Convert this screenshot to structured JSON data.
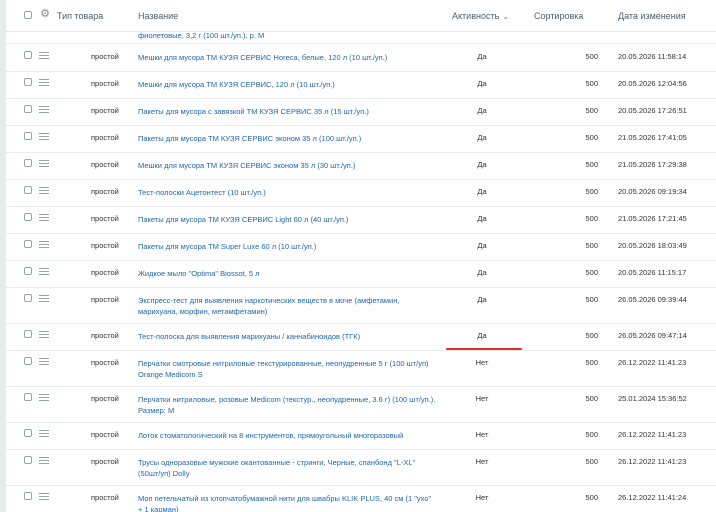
{
  "header": {
    "type_label": "Тип товара",
    "name_label": "Название",
    "activity_label": "Активность",
    "sort_label": "Сортировка",
    "date_label": "Дата изменения"
  },
  "partial_row_text": "фиолетовые, 3,2 г (100 шт./уп.), р. M",
  "rows": [
    {
      "type": "простой",
      "name": "Мешки для мусора ТМ КУЗЯ СЕРВИС Horeca, белые, 120 л (10 шт./уп.)",
      "active": "Да",
      "sort": "500",
      "date": "20.05.2026 11:58:14"
    },
    {
      "type": "простой",
      "name": "Мешки для мусора ТМ КУЗЯ СЕРВИС, 120 л (10 шт./уп.)",
      "active": "Да",
      "sort": "500",
      "date": "20.05.2026 12:04:56"
    },
    {
      "type": "простой",
      "name": "Пакеты для мусора с завязкой ТМ КУЗЯ СЕРВИС 35 л (15 шт./уп.)",
      "active": "Да",
      "sort": "500",
      "date": "20.05.2026 17:26:51"
    },
    {
      "type": "простой",
      "name": "Пакеты для мусора ТМ КУЗЯ СЕРВИС эконом 35 л (100 шт./уп.)",
      "active": "Да",
      "sort": "500",
      "date": "21.05.2026 17:41:05"
    },
    {
      "type": "простой",
      "name": "Мешки для мусора ТМ КУЗЯ СЕРВИС эконом 35 л (30 шт./уп.)",
      "active": "Да",
      "sort": "500",
      "date": "21.05.2026 17:29:38"
    },
    {
      "type": "простой",
      "name": "Тест-полоски Ацетонтест (10 шт./уп.)",
      "active": "Да",
      "sort": "500",
      "date": "20.05.2026 09:19:34"
    },
    {
      "type": "простой",
      "name": "Пакеты для мусора ТМ КУЗЯ СЕРВИС Light 60 л (40 шт./уп.)",
      "active": "Да",
      "sort": "500",
      "date": "21.05.2026 17:21:45"
    },
    {
      "type": "простой",
      "name": "Пакеты для мусора ТМ Super Luxe 60 л (10 шт./уп.)",
      "active": "Да",
      "sort": "500",
      "date": "20.05.2026 18:03:49"
    },
    {
      "type": "простой",
      "name": "Жидкое мыло \"Optima\" Biossot, 5 л",
      "active": "Да",
      "sort": "500",
      "date": "20.05.2026 11:15:17"
    },
    {
      "type": "простой",
      "name": "Экспресс-тест для выявления наркотических веществ в моче (амфетамин, марихуана, морфин, метамфетамин)",
      "active": "Да",
      "sort": "500",
      "date": "26.05.2026 09:39:44"
    },
    {
      "type": "простой",
      "name": "Тест-полоска для выявления марихуаны / каннабиноидов (ТГК)",
      "active": "Да",
      "sort": "500",
      "date": "26.05.2026 09:47:14"
    },
    {
      "type": "простой",
      "name": "Перчатки смотровые нитриловые текстурированные, неопудренные 5 г (100 шт/уп) Orange Medicom S",
      "active": "Нет",
      "sort": "500",
      "date": "26.12.2022 11:41:23"
    },
    {
      "type": "простой",
      "name": "Перчатки нитриловые, розовые Medicom (текстур., неопудренные, 3.6 г) (100 шт/уп.). Размер: M",
      "active": "Нет",
      "sort": "500",
      "date": "25.01.2024 15:36:52"
    },
    {
      "type": "простой",
      "name": "Лоток стоматологический на 8 инструментов, прямоугольный многоразовый",
      "active": "Нет",
      "sort": "500",
      "date": "26.12.2022 11:41:23"
    },
    {
      "type": "простой",
      "name": "Трусы одноразовые мужские оканто­ванные - стринги, Черные, спанбонд \"L-XL\" (50шт/уп) Dolly",
      "active": "Нет",
      "sort": "500",
      "date": "26.12.2022 11:41:23"
    },
    {
      "type": "простой",
      "name": "Моп петельчатый из хлопчатобумажной нити для швабры KLIK PLUS, 40 см (1 \"ухо\" + 1 карман)",
      "active": "Нет",
      "sort": "500",
      "date": "26.12.2022 11:41:24"
    }
  ]
}
